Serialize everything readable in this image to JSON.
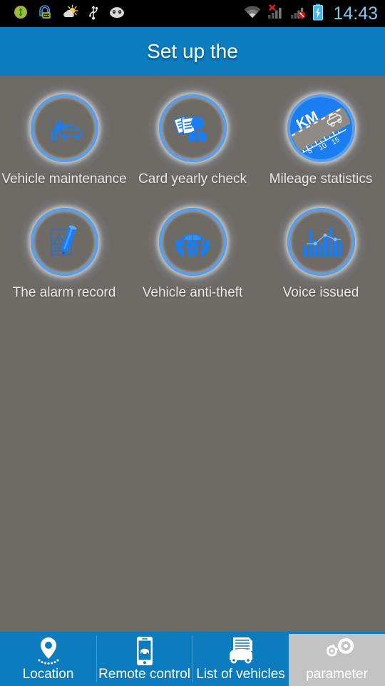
{
  "statusbar": {
    "time": "14:43",
    "left_icons": [
      {
        "name": "sync-status-icon"
      },
      {
        "name": "message-person-icon"
      },
      {
        "name": "weather-icon"
      },
      {
        "name": "usb-icon"
      },
      {
        "name": "android-head-icon"
      }
    ],
    "right_icons": [
      {
        "name": "wifi-icon"
      },
      {
        "name": "signal-bars-no-service-icon"
      },
      {
        "name": "signal-bars-muted-icon"
      },
      {
        "name": "battery-charging-icon"
      }
    ]
  },
  "header": {
    "title": "Set up the"
  },
  "grid": {
    "items": [
      {
        "label": "Vehicle maintenance",
        "icon": "wrench-car-icon",
        "style": "ring"
      },
      {
        "label": "Card yearly check",
        "icon": "person-documents-icon",
        "style": "ring"
      },
      {
        "label": "Mileage statistics",
        "icon": "mileage-km-road-icon",
        "style": "filled"
      },
      {
        "label": "The alarm record",
        "icon": "warning-document-pencil-icon",
        "style": "ring"
      },
      {
        "label": "Vehicle anti-theft",
        "icon": "hands-car-icon",
        "style": "ring"
      },
      {
        "label": "Voice issued",
        "icon": "audio-waveform-icon",
        "style": "ring"
      }
    ]
  },
  "mileage_icon": {
    "unit_label": "KM",
    "scale_labels": [
      "5",
      "10",
      "15"
    ]
  },
  "bottomnav": {
    "tabs": [
      {
        "label": "Location",
        "icon": "map-pin-icon",
        "active": false
      },
      {
        "label": "Remote control",
        "icon": "phone-car-icon",
        "active": false
      },
      {
        "label": "List of vehicles",
        "icon": "list-car-icon",
        "active": false
      },
      {
        "label": "parameter",
        "icon": "gears-icon",
        "active": true
      }
    ]
  },
  "colors": {
    "accent_blue": "#0c7cbe",
    "icon_blue": "#1a7ef2",
    "ring_blue": "#5b9ee8",
    "background_gray": "#6e6a66",
    "active_tab_gray": "#c3c3c3",
    "clock_blue": "#7ec7ef"
  }
}
